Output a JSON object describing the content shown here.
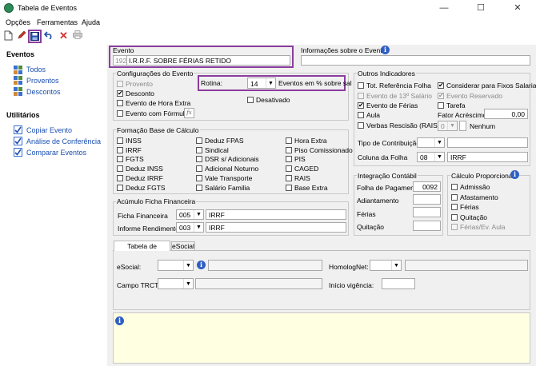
{
  "window": {
    "title": "Tabela de Eventos",
    "minimize": "—",
    "maximize": "☐",
    "close": "✕"
  },
  "menu": [
    "Opções",
    "Ferramentas",
    "Ajuda"
  ],
  "toolbar": {
    "new": "new-file-icon",
    "edit": "edit-icon",
    "save": "save-icon",
    "undo": "undo-icon",
    "delete": "delete-icon",
    "print": "print-icon"
  },
  "sidebar": {
    "evento_header": "Eventos",
    "evento_items": [
      "Todos",
      "Proventos",
      "Descontos"
    ],
    "util_header": "Utilitários",
    "util_items": [
      "Copiar Evento",
      "Análise de Conferência",
      "Comparar Eventos"
    ]
  },
  "evento": {
    "label": "Evento",
    "code": "192",
    "name": "I.R.R.F. SOBRE FÉRIAS RETIDO"
  },
  "info_evento": {
    "label": "Informações sobre o Evento",
    "value": ""
  },
  "config": {
    "title": "Configurações do Evento",
    "provento": "Provento",
    "desconto": "Desconto",
    "hora_extra": "Evento de Hora Extra",
    "formula": "Evento com Fórmula",
    "rotina_label": "Rotina:",
    "rotina_value": "14",
    "rotina_desc": "Eventos em % sobre sal",
    "desativado": "Desativado",
    "fx": "fx"
  },
  "outros": {
    "title": "Outros Indicadores",
    "tot_ref": "Tot. Referência Folha",
    "considerar": "Considerar para Fixos Salariais",
    "decimo": "Evento de 13º Salário",
    "reservado": "Evento Reservado",
    "ferias": "Evento de Férias",
    "tarefa": "Tarefa",
    "aula": "Aula",
    "fator_label": "Fator Acréscimo",
    "fator_value": "0,00",
    "verbas": "Verbas Rescisão (RAIS)",
    "verbas_code": "0",
    "verbas_desc": "Nenhum",
    "tipo_contrib": "Tipo de Contribuição",
    "tipo_value": "",
    "coluna_label": "Coluna da Folha",
    "coluna_value": "08",
    "coluna_desc": "IRRF"
  },
  "formacao": {
    "title": "Formação Base de Cálculo",
    "col1": [
      "INSS",
      "IRRF",
      "FGTS",
      "Deduz INSS",
      "Deduz IRRF",
      "Deduz FGTS"
    ],
    "col2": [
      "Deduz FPAS",
      "Sindical",
      "DSR s/ Adicionais",
      "Adicional Noturno",
      "Vale Transporte",
      "Salário Familia"
    ],
    "col3": [
      "Hora Extra",
      "Piso Comissionado",
      "PIS",
      "CAGED",
      "RAIS",
      "Base Extra"
    ]
  },
  "acumulo": {
    "title": "Acúmulo Ficha Financeira",
    "ficha_label": "Ficha Financeira",
    "ficha_code": "005",
    "ficha_desc": "IRRF",
    "inf_label": "Informe Rendimentos",
    "inf_code": "003",
    "inf_desc": "IRRF"
  },
  "integracao": {
    "title": "Integração Contábil",
    "folha_label": "Folha de Pagamento",
    "folha_value": "0092",
    "adiant_label": "Adiantamento",
    "ferias_label": "Férias",
    "quitacao_label": "Quitação"
  },
  "calculo": {
    "title": "Cálculo Proporcional",
    "items": [
      "Admissão",
      "Afastamento",
      "Férias",
      "Quitação",
      "Férias/Ev. Aula"
    ]
  },
  "tabs": {
    "rubricas": "Tabela de Rubricas",
    "esocial": "eSocial"
  },
  "esocial": {
    "esocial_label": "eSocial:",
    "campo_label": "Campo TRCT:",
    "homolog_label": "HomologNet:",
    "inicio_label": "Início vigência:"
  }
}
